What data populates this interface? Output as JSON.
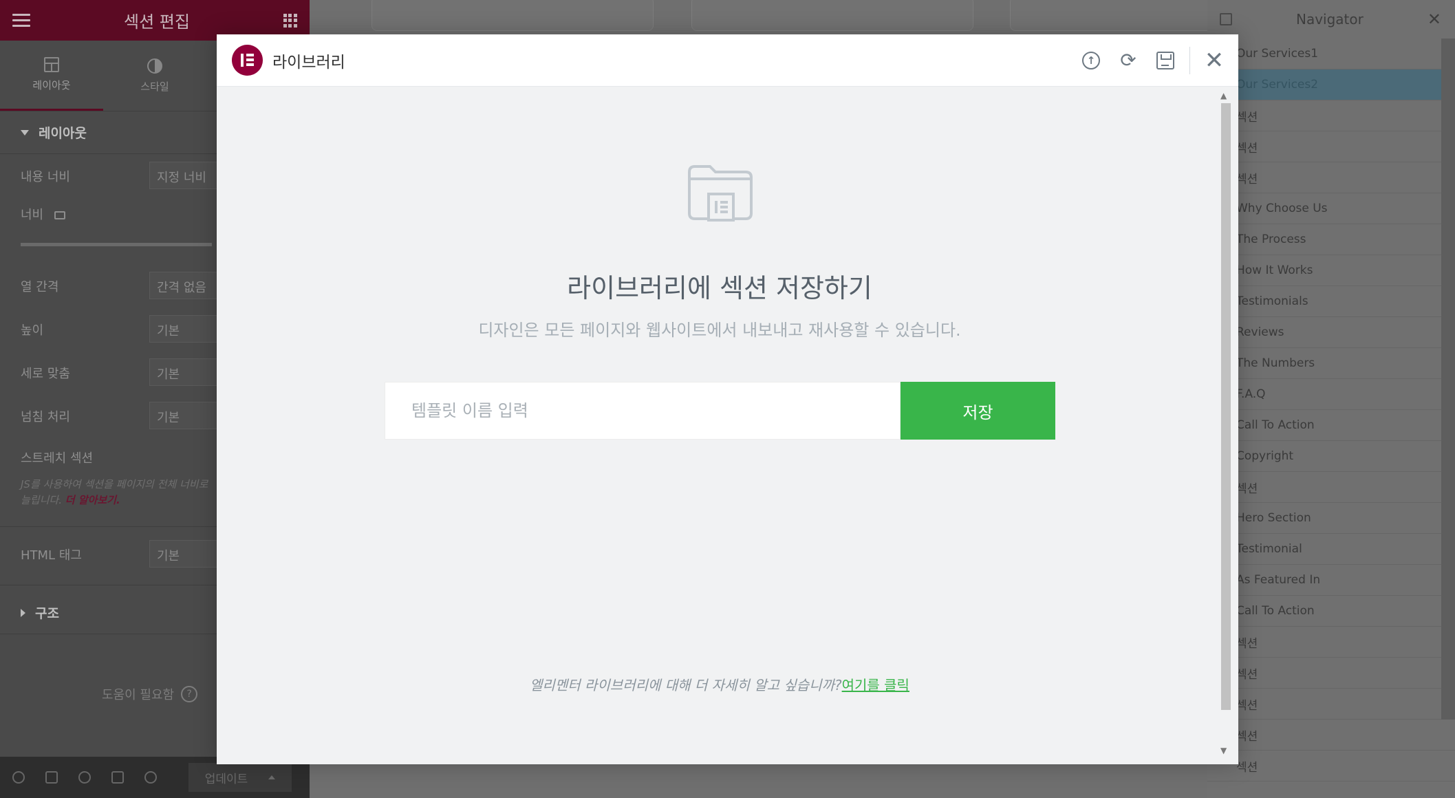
{
  "panel": {
    "title": "섹션 편집",
    "tabs": [
      {
        "label": "레이아웃",
        "icon": "layout-icon"
      },
      {
        "label": "스타일",
        "icon": "contrast-icon"
      }
    ],
    "section_title": "레이아웃",
    "fields": [
      {
        "label": "내용 너비",
        "value": "지정 너비"
      },
      {
        "label": "너비",
        "value": ""
      },
      {
        "label": "열 간격",
        "value": "간격 없음"
      },
      {
        "label": "높이",
        "value": "기본"
      },
      {
        "label": "세로 맞춤",
        "value": "기본"
      },
      {
        "label": "넘침 처리",
        "value": "기본"
      },
      {
        "label": "스트레치 섹션",
        "value": ""
      },
      {
        "label": "HTML 태그",
        "value": "기본"
      }
    ],
    "hint_text": "JS를 사용하여 섹션을 페이지의 전체 너비로 늘립니다.",
    "hint_link": "더 알아보기.",
    "structure_title": "구조",
    "help_text": "도움이 필요함",
    "update_label": "업데이트"
  },
  "navigator": {
    "title": "Navigator",
    "items": [
      "Our Services1",
      "Our Services2",
      "섹션",
      "섹션",
      "섹션",
      "Why Choose Us",
      "The Process",
      "How It Works",
      "Testimonials",
      "Reviews",
      "The Numbers",
      "F.A.Q",
      "Call To Action",
      "Copyright",
      "섹션",
      "Hero Section",
      "Testimonial",
      "As Featured In",
      "Call To Action",
      "섹션",
      "섹션",
      "섹션",
      "섹션",
      "섹션"
    ],
    "active_index": 1
  },
  "modal": {
    "title": "라이브러리",
    "heading": "라이브러리에 섹션 저장하기",
    "subheading": "디자인은 모든 페이지와 웹사이트에서 내보내고 재사용할 수 있습니다.",
    "input_placeholder": "템플릿 이름 입력",
    "input_value": "",
    "save_label": "저장",
    "footer_text": "엘리멘터 라이브러리에 대해 더 자세히 알고 싶습니까?",
    "footer_link": "여기를 클릭",
    "colors": {
      "brand": "#92003b",
      "save": "#39b54a"
    }
  }
}
